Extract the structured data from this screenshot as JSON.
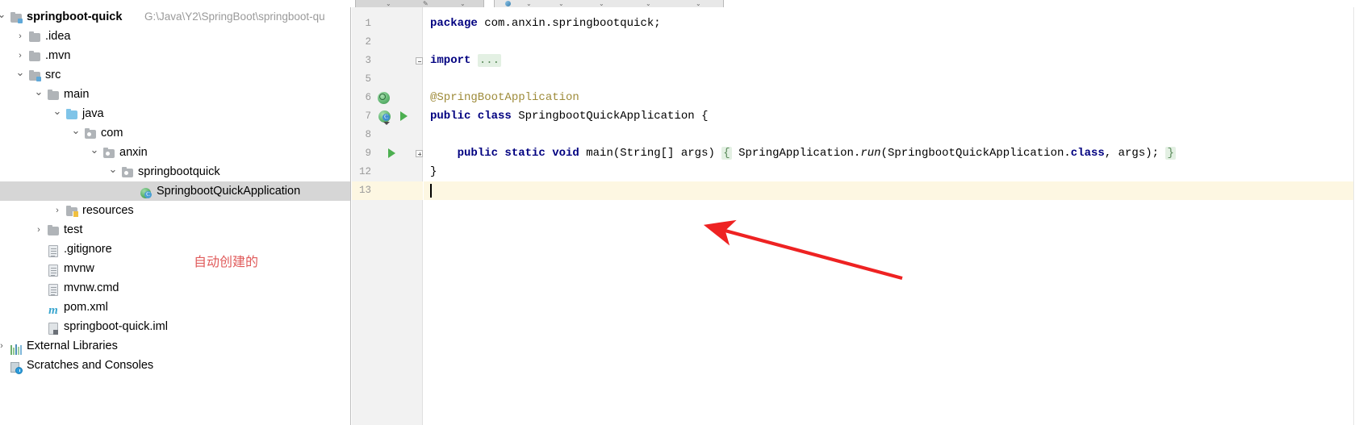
{
  "window": {
    "ide": "IntelliJ IDEA",
    "tabstrip": {
      "active_tab_hint": "",
      "visible": true
    }
  },
  "project_tree": {
    "panel_name": "Project",
    "items": [
      {
        "label": "springboot-quick",
        "path_suffix": "G:\\Java\\Y2\\SpringBoot\\springboot-qu",
        "icon": "module-folder-icon",
        "depth": 0,
        "arrow": "expanded",
        "bold": true,
        "selected": false
      },
      {
        "label": ".idea",
        "icon": "folder-icon",
        "depth": 1,
        "arrow": "collapsed",
        "bold": false,
        "selected": false
      },
      {
        "label": ".mvn",
        "icon": "folder-icon",
        "depth": 1,
        "arrow": "collapsed",
        "bold": false,
        "selected": false
      },
      {
        "label": "src",
        "icon": "source-folder-icon",
        "depth": 1,
        "arrow": "expanded",
        "bold": false,
        "selected": false
      },
      {
        "label": "main",
        "icon": "folder-icon",
        "depth": 2,
        "arrow": "expanded",
        "bold": false,
        "selected": false
      },
      {
        "label": "java",
        "icon": "source-root-folder-icon",
        "depth": 3,
        "arrow": "expanded",
        "bold": false,
        "selected": false
      },
      {
        "label": "com",
        "icon": "package-icon",
        "depth": 4,
        "arrow": "expanded",
        "bold": false,
        "selected": false
      },
      {
        "label": "anxin",
        "icon": "package-icon",
        "depth": 5,
        "arrow": "expanded",
        "bold": false,
        "selected": false
      },
      {
        "label": "springbootquick",
        "icon": "package-icon",
        "depth": 6,
        "arrow": "expanded",
        "bold": false,
        "selected": false
      },
      {
        "label": "SpringbootQuickApplication",
        "icon": "spring-class-icon",
        "depth": 7,
        "arrow": "none",
        "bold": false,
        "selected": true
      },
      {
        "label": "resources",
        "icon": "resources-folder-icon",
        "depth": 3,
        "arrow": "collapsed",
        "bold": false,
        "selected": false
      },
      {
        "label": "test",
        "icon": "folder-icon",
        "depth": 2,
        "arrow": "collapsed",
        "bold": false,
        "selected": false
      },
      {
        "label": ".gitignore",
        "icon": "file-icon",
        "depth": 2,
        "arrow": "none",
        "bold": false,
        "selected": false
      },
      {
        "label": "mvnw",
        "icon": "file-icon",
        "depth": 2,
        "arrow": "none",
        "bold": false,
        "selected": false
      },
      {
        "label": "mvnw.cmd",
        "icon": "file-icon",
        "depth": 2,
        "arrow": "none",
        "bold": false,
        "selected": false
      },
      {
        "label": "pom.xml",
        "icon": "maven-icon",
        "depth": 2,
        "arrow": "none",
        "bold": false,
        "selected": false
      },
      {
        "label": "springboot-quick.iml",
        "icon": "iml-module-icon",
        "depth": 2,
        "arrow": "none",
        "bold": false,
        "selected": false
      },
      {
        "label": "External Libraries",
        "icon": "external-libraries-icon",
        "depth": 0,
        "arrow": "collapsed",
        "bold": false,
        "selected": false
      },
      {
        "label": "Scratches and Consoles",
        "icon": "scratches-icon",
        "depth": 0,
        "arrow": "none",
        "bold": false,
        "selected": false
      }
    ]
  },
  "annotation": {
    "text": "自动创建的",
    "color": "#e05a5a",
    "arrow_color": "#ee2222",
    "arrow_name": "red-pointer-arrow"
  },
  "editor": {
    "file": "SpringbootQuickApplication",
    "language": "java",
    "caret_line": 13,
    "lines": [
      {
        "num": "1",
        "segments": [
          {
            "t": "package",
            "s": "kw"
          },
          {
            "t": " com.anxin.springbootquick;",
            "s": "plain"
          }
        ],
        "gutter": []
      },
      {
        "num": "2",
        "segments": [],
        "gutter": []
      },
      {
        "num": "3",
        "segments": [
          {
            "t": "import",
            "s": "kw"
          },
          {
            "t": " ",
            "s": "plain"
          },
          {
            "t": "...",
            "s": "fold"
          }
        ],
        "gutter": [
          "fold-minus"
        ]
      },
      {
        "num": "5",
        "segments": [],
        "gutter": []
      },
      {
        "num": "6",
        "segments": [
          {
            "t": "@SpringBootApplication",
            "s": "anno"
          }
        ],
        "gutter": [
          "spring-bean-icon"
        ]
      },
      {
        "num": "7",
        "segments": [
          {
            "t": "public class",
            "s": "kw"
          },
          {
            "t": " SpringbootQuickApplication {",
            "s": "plain"
          }
        ],
        "gutter": [
          "spring-class-icon",
          "run-arrow-icon"
        ]
      },
      {
        "num": "8",
        "segments": [],
        "gutter": []
      },
      {
        "num": "9",
        "segments": [
          {
            "t": "    ",
            "s": "plain"
          },
          {
            "t": "public static void",
            "s": "kw"
          },
          {
            "t": " main(String[] args) ",
            "s": "plain"
          },
          {
            "t": "{",
            "s": "fold"
          },
          {
            "t": " SpringApplication.",
            "s": "plain"
          },
          {
            "t": "run",
            "s": "stat"
          },
          {
            "t": "(SpringbootQuickApplication.",
            "s": "plain"
          },
          {
            "t": "class",
            "s": "kw"
          },
          {
            "t": ", args); ",
            "s": "plain"
          },
          {
            "t": "}",
            "s": "fold"
          }
        ],
        "gutter": [
          "run-arrow-icon",
          "fold-plus"
        ]
      },
      {
        "num": "12",
        "segments": [
          {
            "t": "}",
            "s": "plain"
          }
        ],
        "gutter": []
      },
      {
        "num": "13",
        "segments": [],
        "gutter": [],
        "caret": true
      }
    ]
  },
  "colors": {
    "keyword": "#000080",
    "annotation": "#9e8b3a",
    "fold_bg": "#e3f0e3",
    "caret_line_bg": "#fdf7e2",
    "selection_bg": "#d6d6d6",
    "gutter_bg": "#f2f2f2",
    "path_text": "#9a9a9a"
  }
}
